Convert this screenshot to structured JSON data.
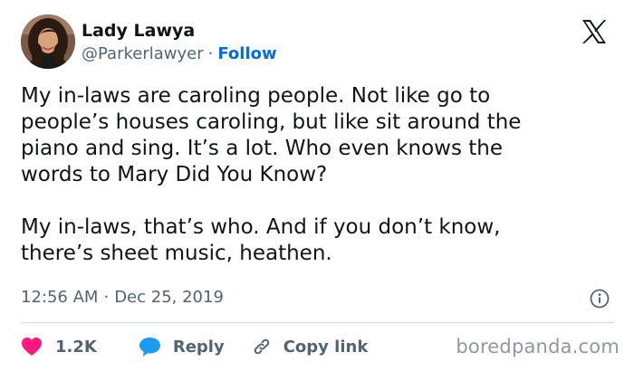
{
  "author": {
    "name": "Lady Lawya",
    "handle": "@Parkerlawyer",
    "separator": "·",
    "follow_label": "Follow",
    "avatar_icon": "profile-photo"
  },
  "platform_icon": "x-logo-icon",
  "tweet": {
    "paragraphs": [
      "My in-laws are caroling people. Not like go to\npeople’s houses caroling, but like sit around the\npiano and sing. It’s a lot. Who even knows the\nwords to Mary Did You Know?",
      "My in-laws, that’s who. And if you don’t know,\nthere’s sheet music, heathen."
    ],
    "time": "12:56 AM",
    "meta_separator": "·",
    "date": "Dec 25, 2019"
  },
  "actions": {
    "likes": "1.2K",
    "reply_label": "Reply",
    "copy_link_label": "Copy link"
  },
  "watermark": "boredpanda.com",
  "colors": {
    "text": "#0f1419",
    "secondary": "#536471",
    "follow": "#006fd6",
    "like": "#f91880",
    "reply": "#1d9bf0",
    "divider": "#cfd9de"
  }
}
